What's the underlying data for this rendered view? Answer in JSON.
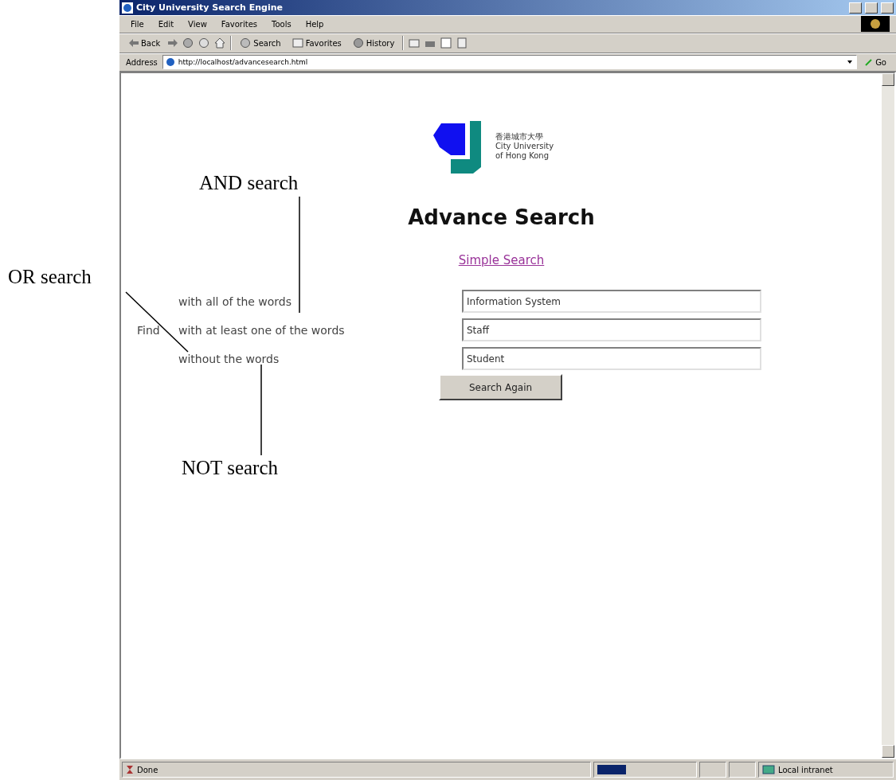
{
  "window": {
    "title": "City University Search Engine"
  },
  "menu": [
    "File",
    "Edit",
    "View",
    "Favorites",
    "Tools",
    "Help"
  ],
  "toolbar": [
    "Back",
    "Search",
    "Favorites",
    "History"
  ],
  "address": {
    "label": "Address",
    "url": "http://localhost/advancesearch.html",
    "go": "Go"
  },
  "logo": {
    "chinese": "香港城市大學",
    "lines": [
      "City University",
      "of Hong Kong"
    ]
  },
  "heading": "Advance Search",
  "link": "Simple Search",
  "find_label": "Find",
  "fields": [
    {
      "label": "with all of the words",
      "value": "Information System"
    },
    {
      "label": "with at least one of the words",
      "value": "Staff"
    },
    {
      "label": "without the words",
      "value": "Student"
    }
  ],
  "button": "Search Again",
  "status": {
    "text": "Done",
    "zone": "Local intranet"
  },
  "annotations": [
    "AND search",
    "OR search",
    "NOT search"
  ]
}
